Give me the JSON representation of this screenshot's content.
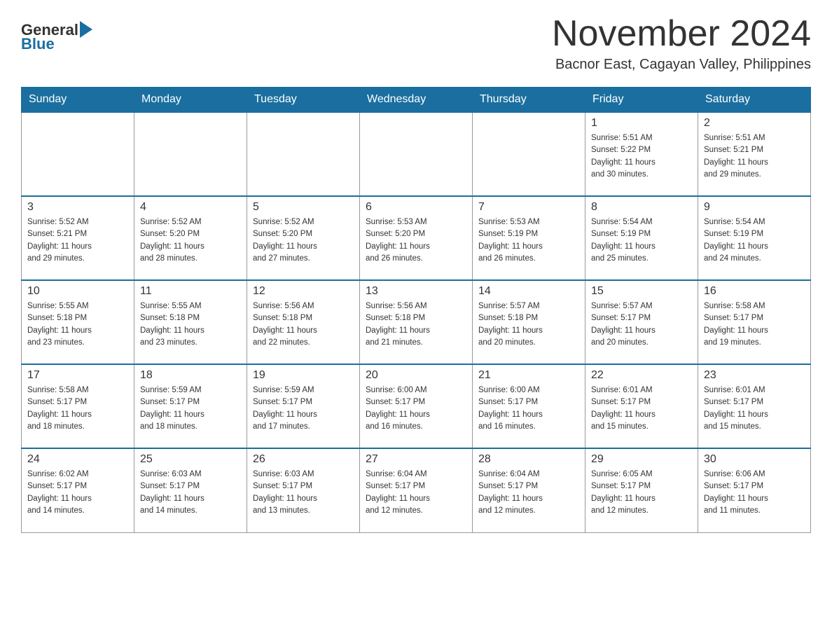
{
  "header": {
    "logo_general": "General",
    "logo_blue": "Blue",
    "month_title": "November 2024",
    "subtitle": "Bacnor East, Cagayan Valley, Philippines"
  },
  "weekdays": [
    "Sunday",
    "Monday",
    "Tuesday",
    "Wednesday",
    "Thursday",
    "Friday",
    "Saturday"
  ],
  "weeks": [
    [
      {
        "day": "",
        "info": ""
      },
      {
        "day": "",
        "info": ""
      },
      {
        "day": "",
        "info": ""
      },
      {
        "day": "",
        "info": ""
      },
      {
        "day": "",
        "info": ""
      },
      {
        "day": "1",
        "info": "Sunrise: 5:51 AM\nSunset: 5:22 PM\nDaylight: 11 hours\nand 30 minutes."
      },
      {
        "day": "2",
        "info": "Sunrise: 5:51 AM\nSunset: 5:21 PM\nDaylight: 11 hours\nand 29 minutes."
      }
    ],
    [
      {
        "day": "3",
        "info": "Sunrise: 5:52 AM\nSunset: 5:21 PM\nDaylight: 11 hours\nand 29 minutes."
      },
      {
        "day": "4",
        "info": "Sunrise: 5:52 AM\nSunset: 5:20 PM\nDaylight: 11 hours\nand 28 minutes."
      },
      {
        "day": "5",
        "info": "Sunrise: 5:52 AM\nSunset: 5:20 PM\nDaylight: 11 hours\nand 27 minutes."
      },
      {
        "day": "6",
        "info": "Sunrise: 5:53 AM\nSunset: 5:20 PM\nDaylight: 11 hours\nand 26 minutes."
      },
      {
        "day": "7",
        "info": "Sunrise: 5:53 AM\nSunset: 5:19 PM\nDaylight: 11 hours\nand 26 minutes."
      },
      {
        "day": "8",
        "info": "Sunrise: 5:54 AM\nSunset: 5:19 PM\nDaylight: 11 hours\nand 25 minutes."
      },
      {
        "day": "9",
        "info": "Sunrise: 5:54 AM\nSunset: 5:19 PM\nDaylight: 11 hours\nand 24 minutes."
      }
    ],
    [
      {
        "day": "10",
        "info": "Sunrise: 5:55 AM\nSunset: 5:18 PM\nDaylight: 11 hours\nand 23 minutes."
      },
      {
        "day": "11",
        "info": "Sunrise: 5:55 AM\nSunset: 5:18 PM\nDaylight: 11 hours\nand 23 minutes."
      },
      {
        "day": "12",
        "info": "Sunrise: 5:56 AM\nSunset: 5:18 PM\nDaylight: 11 hours\nand 22 minutes."
      },
      {
        "day": "13",
        "info": "Sunrise: 5:56 AM\nSunset: 5:18 PM\nDaylight: 11 hours\nand 21 minutes."
      },
      {
        "day": "14",
        "info": "Sunrise: 5:57 AM\nSunset: 5:18 PM\nDaylight: 11 hours\nand 20 minutes."
      },
      {
        "day": "15",
        "info": "Sunrise: 5:57 AM\nSunset: 5:17 PM\nDaylight: 11 hours\nand 20 minutes."
      },
      {
        "day": "16",
        "info": "Sunrise: 5:58 AM\nSunset: 5:17 PM\nDaylight: 11 hours\nand 19 minutes."
      }
    ],
    [
      {
        "day": "17",
        "info": "Sunrise: 5:58 AM\nSunset: 5:17 PM\nDaylight: 11 hours\nand 18 minutes."
      },
      {
        "day": "18",
        "info": "Sunrise: 5:59 AM\nSunset: 5:17 PM\nDaylight: 11 hours\nand 18 minutes."
      },
      {
        "day": "19",
        "info": "Sunrise: 5:59 AM\nSunset: 5:17 PM\nDaylight: 11 hours\nand 17 minutes."
      },
      {
        "day": "20",
        "info": "Sunrise: 6:00 AM\nSunset: 5:17 PM\nDaylight: 11 hours\nand 16 minutes."
      },
      {
        "day": "21",
        "info": "Sunrise: 6:00 AM\nSunset: 5:17 PM\nDaylight: 11 hours\nand 16 minutes."
      },
      {
        "day": "22",
        "info": "Sunrise: 6:01 AM\nSunset: 5:17 PM\nDaylight: 11 hours\nand 15 minutes."
      },
      {
        "day": "23",
        "info": "Sunrise: 6:01 AM\nSunset: 5:17 PM\nDaylight: 11 hours\nand 15 minutes."
      }
    ],
    [
      {
        "day": "24",
        "info": "Sunrise: 6:02 AM\nSunset: 5:17 PM\nDaylight: 11 hours\nand 14 minutes."
      },
      {
        "day": "25",
        "info": "Sunrise: 6:03 AM\nSunset: 5:17 PM\nDaylight: 11 hours\nand 14 minutes."
      },
      {
        "day": "26",
        "info": "Sunrise: 6:03 AM\nSunset: 5:17 PM\nDaylight: 11 hours\nand 13 minutes."
      },
      {
        "day": "27",
        "info": "Sunrise: 6:04 AM\nSunset: 5:17 PM\nDaylight: 11 hours\nand 12 minutes."
      },
      {
        "day": "28",
        "info": "Sunrise: 6:04 AM\nSunset: 5:17 PM\nDaylight: 11 hours\nand 12 minutes."
      },
      {
        "day": "29",
        "info": "Sunrise: 6:05 AM\nSunset: 5:17 PM\nDaylight: 11 hours\nand 12 minutes."
      },
      {
        "day": "30",
        "info": "Sunrise: 6:06 AM\nSunset: 5:17 PM\nDaylight: 11 hours\nand 11 minutes."
      }
    ]
  ]
}
